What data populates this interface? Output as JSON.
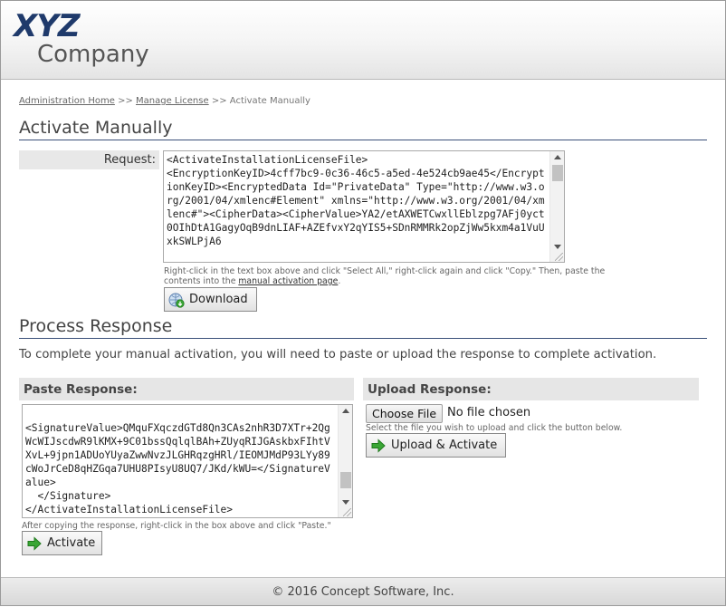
{
  "header": {
    "logo_top": "XYZ",
    "logo_bottom": "Company"
  },
  "breadcrumb": {
    "items": [
      "Administration Home",
      "Manage License",
      "Activate Manually"
    ],
    "separator": ">>"
  },
  "activate": {
    "title": "Activate Manually",
    "request_label": "Request:",
    "request_text": "<ActivateInstallationLicenseFile>\n<EncryptionKeyID>4cff7bc9-0c36-46c5-a5ed-4e524cb9ae45</EncryptionKeyID><EncryptedData Id=\"PrivateData\" Type=\"http://www.w3.org/2001/04/xmlenc#Element\" xmlns=\"http://www.w3.org/2001/04/xmlenc#\"><CipherData><CipherValue>YA2/etAXWETCwxllEblzpg7AFj0yct0OIhDtA1GagyOqB9dnLIAF+AZEfvxY2qYIS5+SDnRMMRk2opZjWw5kxm4a1VuUxkSWLPjA6",
    "hint_prefix": "Right-click in the text box above and click \"Select All,\" right-click again and click \"Copy.\" Then, paste the contents into the ",
    "hint_link": "manual activation page",
    "hint_suffix": ".",
    "download_label": "Download"
  },
  "process": {
    "title": "Process Response",
    "description": "To complete your manual activation, you will need to paste or upload the response to complete activation.",
    "paste_header": "Paste Response:",
    "paste_text": "<SignatureValue>QMquFXqczdGTd8Qn3CAs2nhR3D7XTr+2QgWcWIJscdwR9lKMX+9C01bssQqlqlBAh+ZUyqRIJGAskbxFIhtVXvL+9jpn1ADUoYUyaZwwNvzJLGHRqzgHRl/IEOMJMdP93LYy89cWoJrCeD8qHZGqa7UHU8PIsyU8UQ7/JKd/kWU=</SignatureValue>\n  </Signature>\n</ActivateInstallationLicenseFile>",
    "paste_hint": "After copying the response, right-click in the box above and click \"Paste.\"",
    "activate_label": "Activate",
    "upload_header": "Upload Response:",
    "choose_file_label": "Choose File",
    "file_status": "No file chosen",
    "upload_hint": "Select the file you wish to upload and click the button below.",
    "upload_activate_label": "Upload & Activate"
  },
  "footer": {
    "copyright": "© 2016 Concept Software, Inc."
  },
  "colors": {
    "accent_rule": "#3a5079",
    "logo_blue": "#1f3a6b",
    "icon_green": "#3aa635"
  },
  "icons": {
    "download": "download-globe-icon",
    "activate": "green-arrow-right-icon"
  }
}
